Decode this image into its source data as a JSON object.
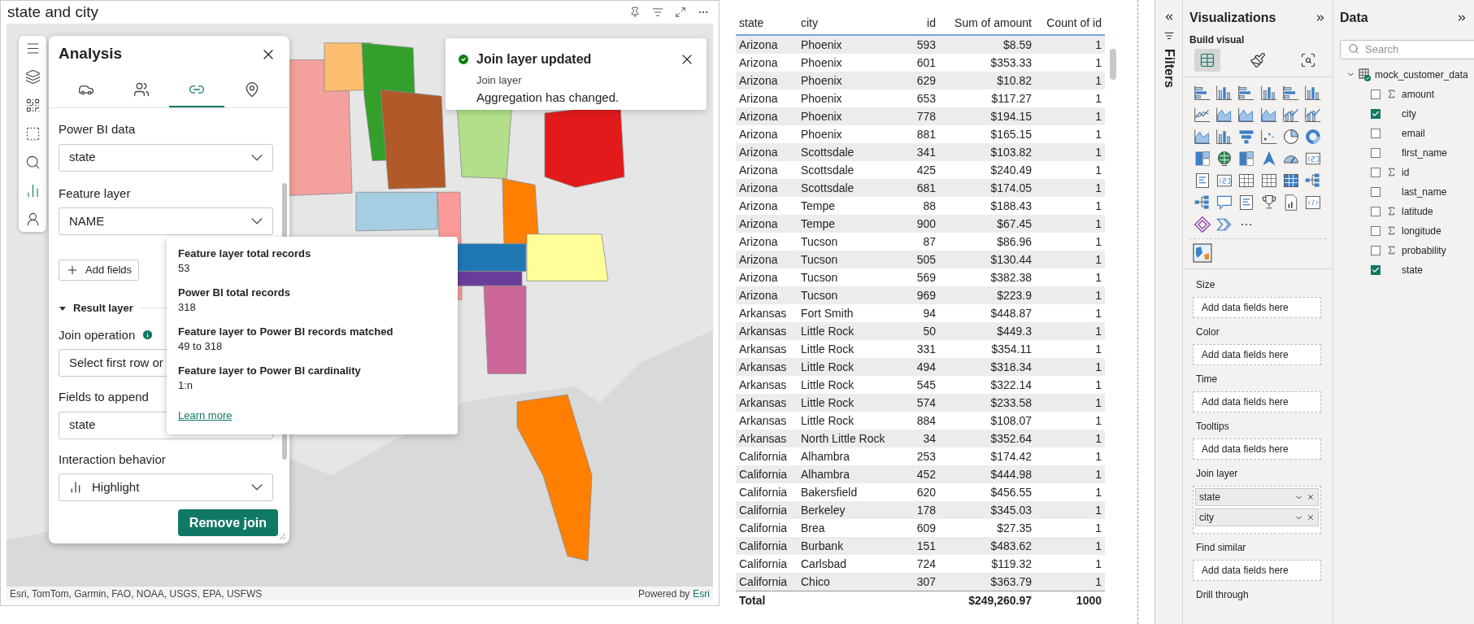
{
  "map_visual": {
    "title": "state and city",
    "attribution": "Esri, TomTom, Garmin, FAO, NOAA, USGS, EPA, USFWS",
    "powered_by": "Powered by",
    "powered_link": "Esri"
  },
  "analysis_panel": {
    "title": "Analysis",
    "tabs": [
      {
        "selected": false
      },
      {
        "selected": false
      },
      {
        "selected": true
      },
      {
        "selected": false
      }
    ],
    "join_fields": [
      {
        "label": "Power BI data",
        "value": "state",
        "info": false,
        "kind": "select"
      },
      {
        "label": "Feature layer",
        "value": "NAME",
        "info": false,
        "kind": "select"
      }
    ],
    "add_fields": "Add fields",
    "section": {
      "label": "Result layer",
      "expanded": true
    },
    "result_fields": [
      {
        "label": "Join operation",
        "value": "Select first row or",
        "info": true,
        "kind": "select"
      },
      {
        "label": "Fields to append",
        "value": "state",
        "info": false,
        "kind": "select"
      },
      {
        "label": "Interaction behavior",
        "value": "Highlight",
        "info": false,
        "kind": "select_with_icon"
      }
    ],
    "remove_button": "Remove join"
  },
  "tooltip": {
    "items": [
      {
        "title": "Feature layer total records",
        "value": "53"
      },
      {
        "title": "Power BI total records",
        "value": "318"
      },
      {
        "title": "Feature layer to Power BI records matched",
        "value": "49 to 318"
      },
      {
        "title": "Feature layer to Power BI cardinality",
        "value": "1:n"
      }
    ],
    "link": "Learn more"
  },
  "toast": {
    "title": "Join layer updated",
    "subtitle": "Join layer",
    "message": "Aggregation has changed."
  },
  "table": {
    "columns": [
      "state",
      "city",
      "id",
      "Sum of amount",
      "Count of id"
    ],
    "rows": [
      [
        "Arizona",
        "Phoenix",
        "593",
        "$8.59",
        "1"
      ],
      [
        "Arizona",
        "Phoenix",
        "601",
        "$353.33",
        "1"
      ],
      [
        "Arizona",
        "Phoenix",
        "629",
        "$10.82",
        "1"
      ],
      [
        "Arizona",
        "Phoenix",
        "653",
        "$117.27",
        "1"
      ],
      [
        "Arizona",
        "Phoenix",
        "778",
        "$194.15",
        "1"
      ],
      [
        "Arizona",
        "Phoenix",
        "881",
        "$165.15",
        "1"
      ],
      [
        "Arizona",
        "Scottsdale",
        "341",
        "$103.82",
        "1"
      ],
      [
        "Arizona",
        "Scottsdale",
        "425",
        "$240.49",
        "1"
      ],
      [
        "Arizona",
        "Scottsdale",
        "681",
        "$174.05",
        "1"
      ],
      [
        "Arizona",
        "Tempe",
        "88",
        "$188.43",
        "1"
      ],
      [
        "Arizona",
        "Tempe",
        "900",
        "$67.45",
        "1"
      ],
      [
        "Arizona",
        "Tucson",
        "87",
        "$86.96",
        "1"
      ],
      [
        "Arizona",
        "Tucson",
        "505",
        "$130.44",
        "1"
      ],
      [
        "Arizona",
        "Tucson",
        "569",
        "$382.38",
        "1"
      ],
      [
        "Arizona",
        "Tucson",
        "969",
        "$223.9",
        "1"
      ],
      [
        "Arkansas",
        "Fort Smith",
        "94",
        "$448.87",
        "1"
      ],
      [
        "Arkansas",
        "Little Rock",
        "50",
        "$449.3",
        "1"
      ],
      [
        "Arkansas",
        "Little Rock",
        "331",
        "$354.11",
        "1"
      ],
      [
        "Arkansas",
        "Little Rock",
        "494",
        "$318.34",
        "1"
      ],
      [
        "Arkansas",
        "Little Rock",
        "545",
        "$322.14",
        "1"
      ],
      [
        "Arkansas",
        "Little Rock",
        "574",
        "$233.58",
        "1"
      ],
      [
        "Arkansas",
        "Little Rock",
        "884",
        "$108.07",
        "1"
      ],
      [
        "Arkansas",
        "North Little Rock",
        "34",
        "$352.64",
        "1"
      ],
      [
        "California",
        "Alhambra",
        "253",
        "$174.42",
        "1"
      ],
      [
        "California",
        "Alhambra",
        "452",
        "$444.98",
        "1"
      ],
      [
        "California",
        "Bakersfield",
        "620",
        "$456.55",
        "1"
      ],
      [
        "California",
        "Berkeley",
        "178",
        "$345.03",
        "1"
      ],
      [
        "California",
        "Brea",
        "609",
        "$27.35",
        "1"
      ],
      [
        "California",
        "Burbank",
        "151",
        "$483.62",
        "1"
      ],
      [
        "California",
        "Carlsbad",
        "724",
        "$119.32",
        "1"
      ],
      [
        "California",
        "Chico",
        "307",
        "$363.79",
        "1"
      ]
    ],
    "total": {
      "label": "Total",
      "sum": "$249,260.97",
      "count": "1000"
    }
  },
  "filters_pane": {
    "label": "Filters"
  },
  "visualizations": {
    "title": "Visualizations",
    "subtitle": "Build visual",
    "modes": [
      {
        "selected": true
      },
      {
        "selected": false
      },
      {
        "selected": false
      }
    ],
    "wells": [
      {
        "label": "Size",
        "hint": "Add data fields here"
      },
      {
        "label": "Color",
        "hint": "Add data fields here"
      },
      {
        "label": "Time",
        "hint": "Add data fields here"
      },
      {
        "label": "Tooltips",
        "hint": "Add data fields here"
      },
      {
        "label": "Join layer",
        "chips": [
          "state",
          "city"
        ]
      },
      {
        "label": "Find similar",
        "hint": "Add data fields here"
      },
      {
        "label": "Drill through"
      }
    ]
  },
  "data_pane": {
    "title": "Data",
    "search": {
      "placeholder": "Search"
    },
    "table": {
      "name": "mock_customer_data",
      "expanded": true,
      "fields": [
        {
          "name": "amount",
          "checked": false,
          "numeric": true
        },
        {
          "name": "city",
          "checked": true,
          "numeric": false
        },
        {
          "name": "email",
          "checked": false,
          "numeric": false
        },
        {
          "name": "first_name",
          "checked": false,
          "numeric": false
        },
        {
          "name": "id",
          "checked": false,
          "numeric": true
        },
        {
          "name": "last_name",
          "checked": false,
          "numeric": false
        },
        {
          "name": "latitude",
          "checked": false,
          "numeric": true
        },
        {
          "name": "longitude",
          "checked": false,
          "numeric": true
        },
        {
          "name": "probability",
          "checked": false,
          "numeric": true
        },
        {
          "name": "state",
          "checked": true,
          "numeric": false
        }
      ]
    }
  }
}
